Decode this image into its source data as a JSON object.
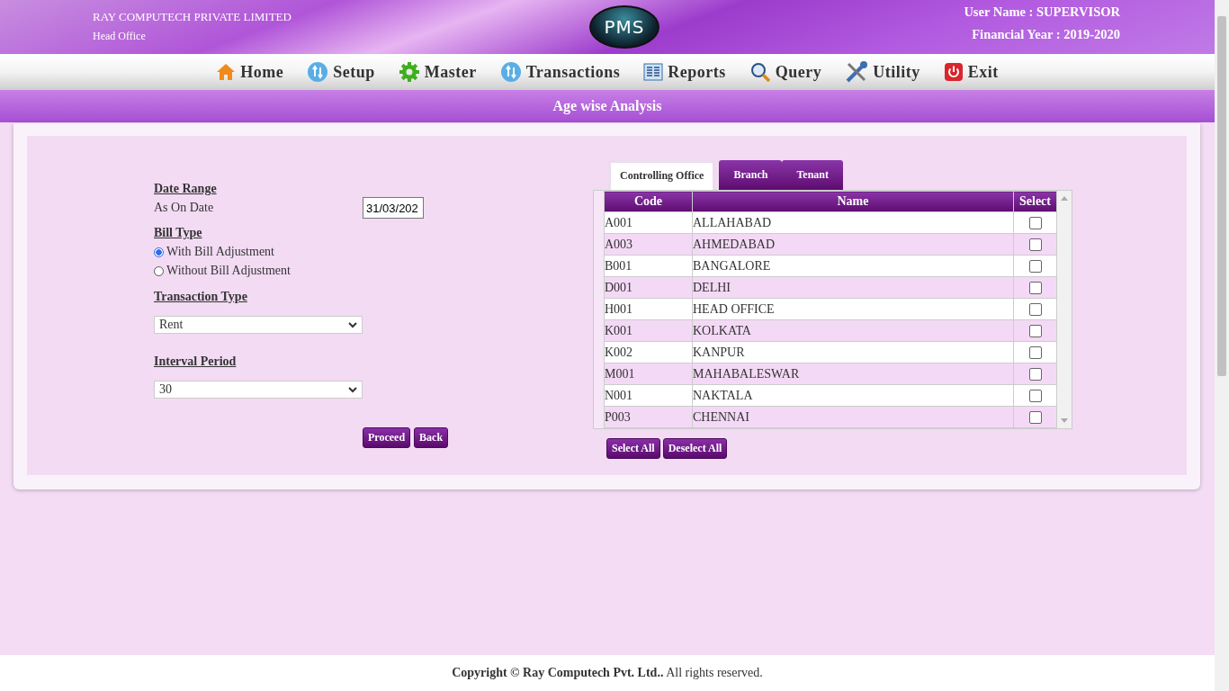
{
  "header": {
    "company": "RAY COMPUTECH PRIVATE LIMITED",
    "office": "Head Office",
    "logo": "PMS",
    "user": "User Name : SUPERVISOR",
    "year": "Financial Year : 2019-2020"
  },
  "nav": [
    {
      "label": "Home",
      "kind": "home"
    },
    {
      "label": "Setup",
      "kind": "arrows"
    },
    {
      "label": "Master",
      "kind": "gear"
    },
    {
      "label": "Transactions",
      "kind": "arrows"
    },
    {
      "label": "Reports",
      "kind": "report"
    },
    {
      "label": "Query",
      "kind": "search"
    },
    {
      "label": "Utility",
      "kind": "tools"
    },
    {
      "label": "Exit",
      "kind": "power"
    }
  ],
  "page_title": "Age wise Analysis",
  "form": {
    "date_heading": "Date Range",
    "as_on_label": "As On Date",
    "as_on_value": "31/03/202",
    "bill_heading": "Bill Type",
    "bill_options": [
      {
        "label": "With Bill Adjustment",
        "selected": true
      },
      {
        "label": "Without Bill Adjustment",
        "selected": false
      }
    ],
    "transaction_heading": "Transaction Type",
    "transaction_value": "Rent",
    "interval_heading": "Interval Period",
    "interval_value": "30",
    "buttons": [
      "Proceed",
      "Back"
    ]
  },
  "tabs": [
    {
      "label": "Controlling Office",
      "selected": true
    },
    {
      "label": "Branch",
      "selected": false
    },
    {
      "label": "Tenant",
      "selected": false
    }
  ],
  "table": {
    "columns": [
      "Code",
      "Name",
      "Select"
    ],
    "rows": [
      {
        "code": "A001",
        "name": "ALLAHABAD",
        "checked": false
      },
      {
        "code": "A003",
        "name": "AHMEDABAD",
        "checked": false
      },
      {
        "code": "B001",
        "name": "BANGALORE",
        "checked": false
      },
      {
        "code": "D001",
        "name": "DELHI",
        "checked": false
      },
      {
        "code": "H001",
        "name": "HEAD OFFICE",
        "checked": false
      },
      {
        "code": "K001",
        "name": "KOLKATA",
        "checked": false
      },
      {
        "code": "K002",
        "name": "KANPUR",
        "checked": false
      },
      {
        "code": "M001",
        "name": "MAHABALESWAR",
        "checked": false
      },
      {
        "code": "N001",
        "name": "NAKTALA",
        "checked": false
      },
      {
        "code": "P003",
        "name": "CHENNAI",
        "checked": false
      }
    ]
  },
  "table_buttons": [
    "Select All",
    "Deselect All"
  ],
  "footer": "**Copyright © Ray Computech Pvt. Ltd..** All rights reserved."
}
